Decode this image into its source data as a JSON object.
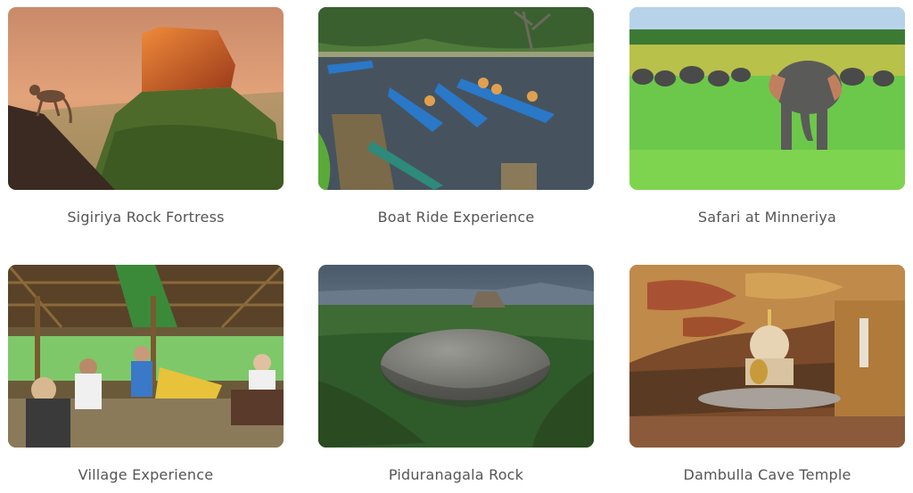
{
  "experiences": [
    {
      "title": "Sigiriya Rock Fortress",
      "icon": "sigiriya-rock-image"
    },
    {
      "title": "Boat Ride Experience",
      "icon": "boat-ride-image"
    },
    {
      "title": "Safari at Minneriya",
      "icon": "elephant-safari-image"
    },
    {
      "title": "Village Experience",
      "icon": "village-hut-image"
    },
    {
      "title": "Piduranagala Rock",
      "icon": "pidurangala-rock-image"
    },
    {
      "title": "Dambulla Cave Temple",
      "icon": "cave-temple-image"
    }
  ]
}
